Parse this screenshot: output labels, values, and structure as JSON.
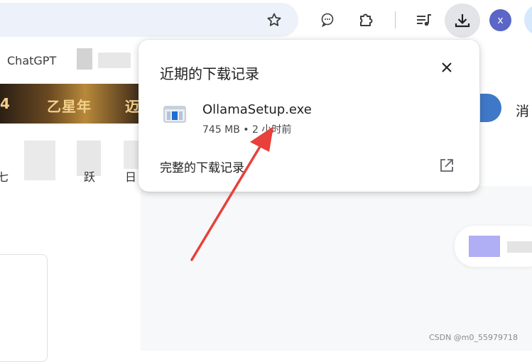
{
  "toolbar": {
    "avatar_letter": "x"
  },
  "bookmarks": {
    "first_label": "ChatGPT"
  },
  "page": {
    "banner_left": "4",
    "banner_text": "乙星年",
    "banner_right": "迈",
    "right_char": "消",
    "nav_chars": [
      "七",
      "跃",
      "日"
    ],
    "watermark": "CSDN @m0_55979718"
  },
  "downloads_popup": {
    "title": "近期的下载记录",
    "item": {
      "file_name": "OllamaSetup.exe",
      "meta": "745 MB • 2 小时前"
    },
    "full_history_label": "完整的下载记录"
  },
  "colors": {
    "accent_arrow": "#e8403a",
    "avatar": "#5b66c6",
    "omnibox": "#edf2fa"
  }
}
